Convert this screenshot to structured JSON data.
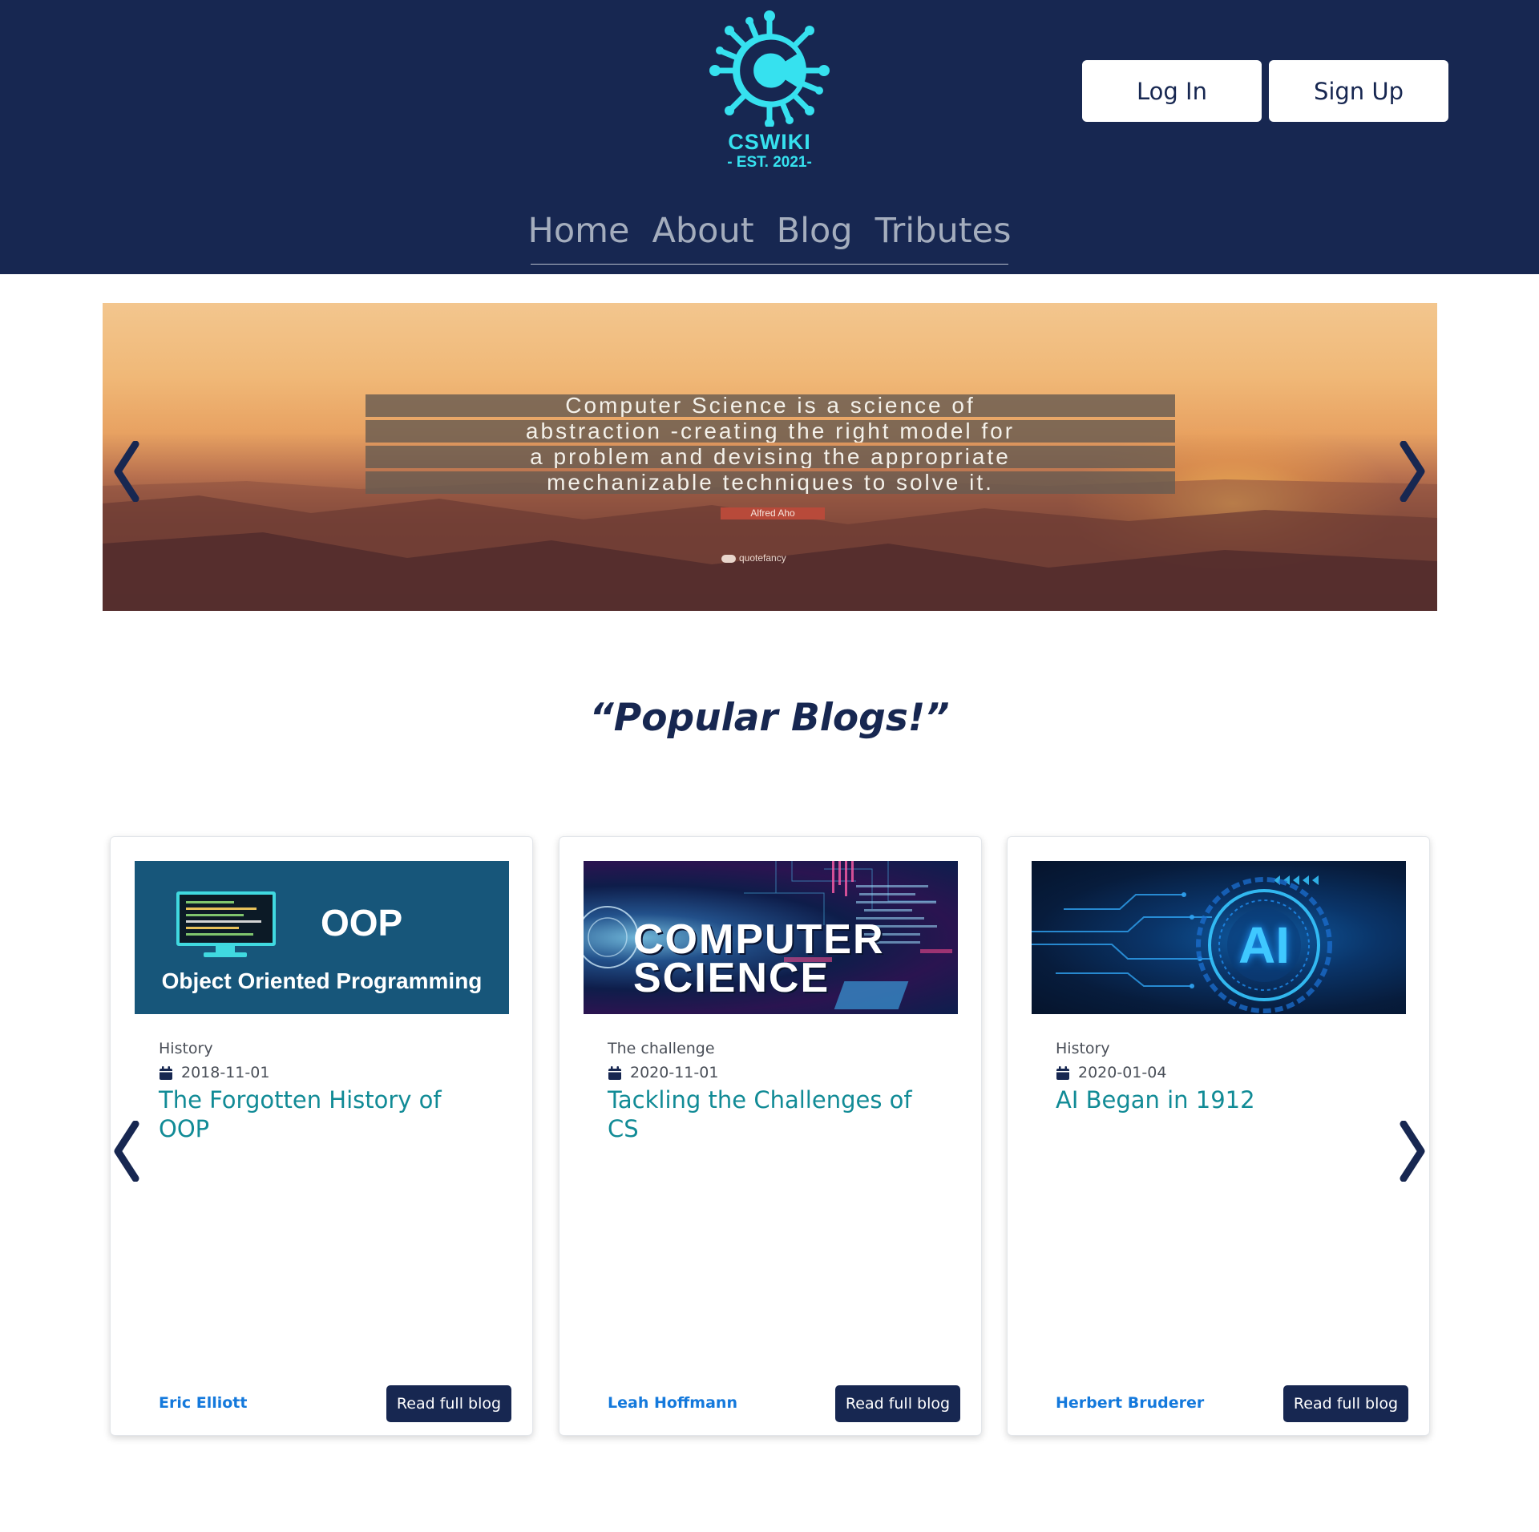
{
  "brand": {
    "name": "CSWIKI",
    "established": "- EST. 2021-",
    "accent_color": "#36e1ef"
  },
  "header": {
    "background_color": "#172751",
    "login_label": "Log In",
    "signup_label": "Sign Up"
  },
  "nav": {
    "items": [
      {
        "label": "Home"
      },
      {
        "label": "About"
      },
      {
        "label": "Blog"
      },
      {
        "label": "Tributes"
      }
    ]
  },
  "hero": {
    "quote_lines": [
      "Computer Science is a science of",
      "abstraction -creating the right model for",
      "a problem and devising the appropriate",
      "mechanizable techniques to solve it."
    ],
    "author": "Alfred Aho",
    "credit": "quotefancy",
    "prev_icon": "chevron-left-icon",
    "next_icon": "chevron-right-icon"
  },
  "popular": {
    "title": "“Popular Blogs!”",
    "cards": [
      {
        "image": {
          "headline": "OOP",
          "subtitle": "Object Oriented Programming"
        },
        "category": "History",
        "date": "2018-11-01",
        "title": "The Forgotten History of OOP",
        "author": "Eric Elliott",
        "button_label": "Read full blog"
      },
      {
        "image": {
          "line1": "COMPUTER",
          "line2": "SCIENCE"
        },
        "category": "The challenge",
        "date": "2020-11-01",
        "title": "Tackling the Challenges of CS",
        "author": "Leah Hoffmann",
        "button_label": "Read full blog"
      },
      {
        "image": {
          "headline": "AI"
        },
        "category": "History",
        "date": "2020-01-04",
        "title": "AI Began in 1912",
        "author": "Herbert Bruderer",
        "button_label": "Read full blog"
      }
    ]
  },
  "colors": {
    "title_teal": "#118b96",
    "author_blue": "#1479dc",
    "button_navy": "#172751"
  }
}
